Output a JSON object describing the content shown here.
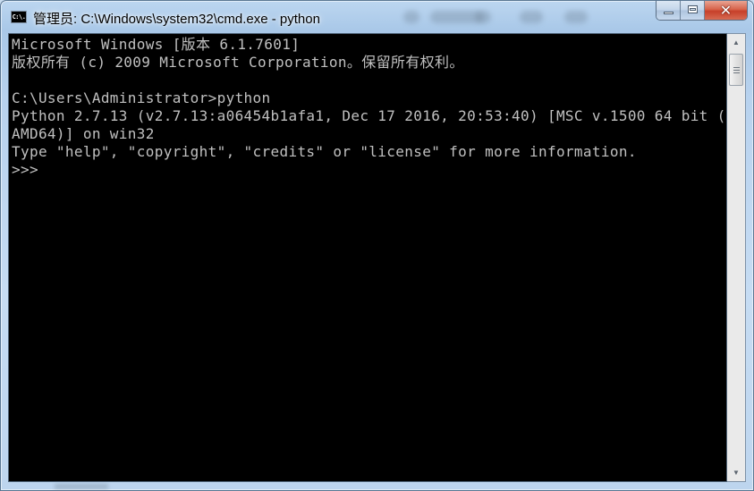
{
  "window": {
    "title": "管理员: C:\\Windows\\system32\\cmd.exe - python",
    "app_icon": "cmd-icon",
    "app_icon_text": "C:\\.",
    "buttons": {
      "minimize": "minimize-icon",
      "maximize": "maximize-icon",
      "close": "close-icon",
      "close_glyph": "✕"
    }
  },
  "console": {
    "background": "#000000",
    "foreground": "#c0c0c0",
    "lines": [
      "Microsoft Windows [版本 6.1.7601]",
      "版权所有 (c) 2009 Microsoft Corporation。保留所有权利。",
      "",
      "C:\\Users\\Administrator>python",
      "Python 2.7.13 (v2.7.13:a06454b1afa1, Dec 17 2016, 20:53:40) [MSC v.1500 64 bit (",
      "AMD64)] on win32",
      "Type \"help\", \"copyright\", \"credits\" or \"license\" for more information.",
      ">>>"
    ]
  },
  "scrollbar": {
    "up_arrow": "▲",
    "down_arrow": "▼",
    "position_fraction": 0.0
  }
}
